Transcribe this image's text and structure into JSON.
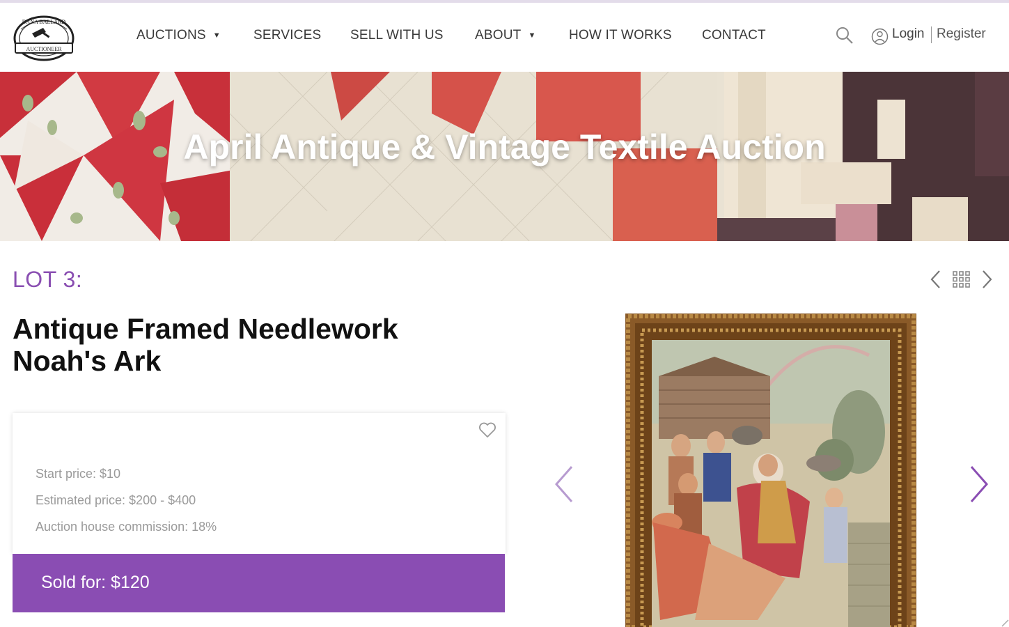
{
  "header": {
    "logo_text": "DANA BALLARD AUCTIONEER",
    "nav": [
      {
        "label": "AUCTIONS",
        "dropdown": true
      },
      {
        "label": "SERVICES",
        "dropdown": false
      },
      {
        "label": "SELL WITH US",
        "dropdown": false
      },
      {
        "label": "ABOUT",
        "dropdown": true
      },
      {
        "label": "HOW IT WORKS",
        "dropdown": false
      },
      {
        "label": "CONTACT",
        "dropdown": false
      }
    ],
    "login": "Login",
    "register": "Register"
  },
  "banner": {
    "title": "April Antique & Vintage Textile Auction"
  },
  "lot": {
    "label": "LOT 3:",
    "title_line1": "Antique Framed Needlework",
    "title_line2": "Noah's Ark",
    "start_price": "Start price: $10",
    "estimated_price": "Estimated price: $200 - $400",
    "commission": "Auction house commission: 18%",
    "sold_for": "Sold for: $120"
  },
  "colors": {
    "accent": "#8a4db3",
    "lot_label": "#8a4fb2",
    "nav_text": "#3a3a3a",
    "muted_text": "#9a9a9a"
  },
  "icons": {
    "search": "search-icon",
    "user": "user-icon",
    "heart": "heart-icon",
    "prev": "chevron-left-icon",
    "next": "chevron-right-icon",
    "grid": "grid-icon"
  }
}
